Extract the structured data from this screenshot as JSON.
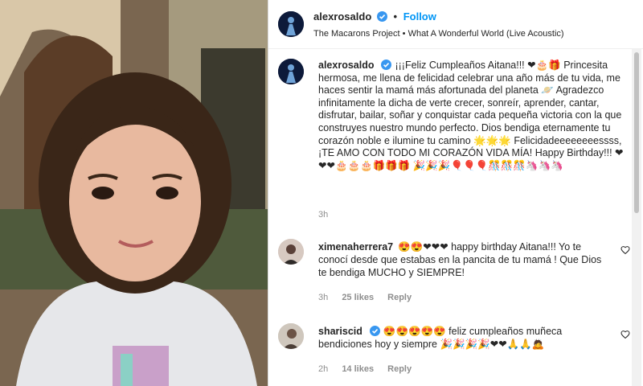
{
  "post": {
    "username": "alexrosaldo",
    "follow_label": "Follow",
    "audio": "The Macarons Project • What A Wonderful World (Live Acoustic)"
  },
  "caption": {
    "username": "alexrosaldo",
    "text": "¡¡¡Feliz Cumpleaños Aitana!!! ❤🎂🎁 Princesita hermosa, me llena de felicidad celebrar una año más de tu vida, me haces sentir la mamá más afortunada del planeta 🪐 Agradezco infinitamente la dicha de verte crecer, sonreír, aprender, cantar, disfrutar, bailar, soñar y conquistar cada pequeña victoria con la que construyes nuestro mundo perfecto. Dios bendiga eternamente tu corazón noble e ilumine tu camino 🌟🌟🌟 Felicidadeeeeeeeessss, ¡TE AMO CON TODO MI CORAZÓN VIDA MÍA! Happy Birthday!!! ❤❤❤🎂🎂🎂🎁🎁🎁 🎉🎉🎉🎈🎈🎈🎊🎊🎊🦄🦄🦄",
    "time": "3h"
  },
  "comments": [
    {
      "username": "ximenaherrera7",
      "text": "😍😍❤❤❤ happy birthday Aitana!!! Yo te conocí desde que estabas en la pancita de tu mamá ! Que Dios te bendiga MUCHO y SIEMPRE!",
      "time": "3h",
      "likes": "25 likes",
      "reply_label": "Reply"
    },
    {
      "username": "shariscid",
      "text": "😍😍😍😍😍 feliz cumpleaños muñeca bendiciones hoy y siempre 🎉🎉🎉🎉❤❤🙏🙏🙇",
      "time": "2h",
      "likes": "14 likes",
      "reply_label": "Reply"
    }
  ],
  "colors": {
    "link": "#0095f6",
    "verified": "#3897f0",
    "text": "#262626",
    "muted": "#8e8e8e"
  }
}
